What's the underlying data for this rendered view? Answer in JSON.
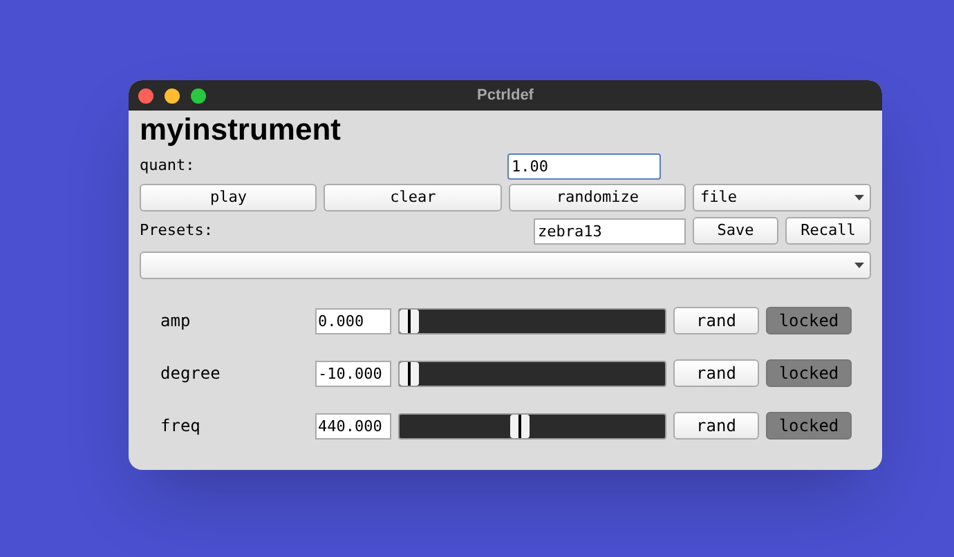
{
  "window": {
    "title": "Pctrldef"
  },
  "heading": "myinstrument",
  "quant": {
    "label": "quant:",
    "value": "1.00"
  },
  "buttons": [
    "play",
    "clear",
    "randomize"
  ],
  "file_menu": {
    "value": "file"
  },
  "presets": {
    "label": "Presets:",
    "value": "zebra13",
    "save": "Save",
    "recall": "Recall"
  },
  "params": [
    {
      "name": "amp",
      "value": "0.000",
      "level": 0,
      "rand": "rand",
      "lock": "locked",
      "locked": true
    },
    {
      "name": "degree",
      "value": "-10.000",
      "level": 0,
      "rand": "rand",
      "lock": "locked",
      "locked": true
    },
    {
      "name": "freq",
      "value": "440.000",
      "level": 0.45,
      "rand": "rand",
      "lock": "locked",
      "locked": true
    }
  ]
}
